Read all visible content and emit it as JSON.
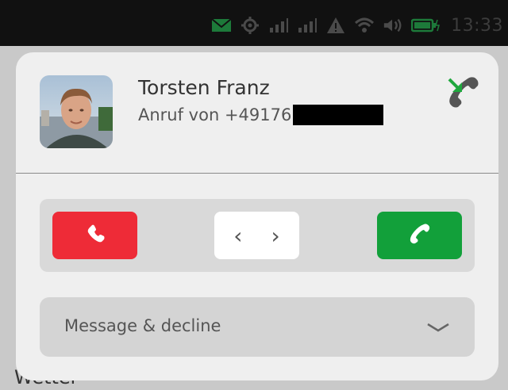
{
  "status_bar": {
    "time": "13:33",
    "icons": [
      "message-icon",
      "location-icon",
      "signal-icon",
      "signal-icon",
      "alert-icon",
      "wifi-icon",
      "volume-icon",
      "battery-icon"
    ]
  },
  "background_app": {
    "visible_text": "Wetter"
  },
  "call": {
    "caller_name": "Torsten Franz",
    "caller_line_prefix": "Anruf von +49176",
    "status_icon": "incoming-call-icon"
  },
  "actions": {
    "decline_icon": "hang-up-icon",
    "slider_left_glyph": "‹",
    "slider_right_glyph": "›",
    "accept_icon": "phone-icon"
  },
  "message_decline": {
    "label": "Message & decline"
  },
  "colors": {
    "decline": "#ee2b37",
    "accept": "#12a03a",
    "incoming_arrow": "#1fa83e"
  }
}
